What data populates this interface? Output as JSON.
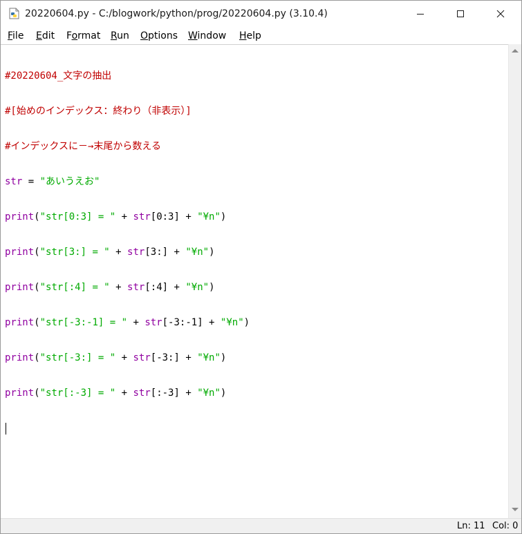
{
  "window": {
    "title": "20220604.py - C:/blogwork/python/prog/20220604.py (3.10.4)"
  },
  "title_buttons": {
    "minimize_icon": "minimize-icon",
    "maximize_icon": "maximize-icon",
    "close_icon": "close-icon"
  },
  "menu": [
    {
      "mnemonic": "F",
      "rest": "ile"
    },
    {
      "mnemonic": "E",
      "rest": "dit"
    },
    {
      "lead": "F",
      "mnemonic": "o",
      "rest": "rmat"
    },
    {
      "mnemonic": "R",
      "rest": "un"
    },
    {
      "mnemonic": "O",
      "rest": "ptions"
    },
    {
      "mnemonic": "W",
      "rest": "indow"
    },
    {
      "mnemonic": "H",
      "rest": "elp"
    }
  ],
  "code_lines": [
    [
      {
        "t": "#20220604_文字の抽出",
        "k": "comment"
      }
    ],
    [
      {
        "t": "#[始めのインデックス：終わり（非表示）]",
        "k": "comment"
      }
    ],
    [
      {
        "t": "#インデックスに－→末尾から数える",
        "k": "comment"
      }
    ],
    [
      {
        "t": "str",
        "k": "builtin"
      },
      {
        "t": " = ",
        "k": "plain"
      },
      {
        "t": "\"あいうえお\"",
        "k": "string"
      }
    ],
    [
      {
        "t": "print",
        "k": "builtin"
      },
      {
        "t": "(",
        "k": "plain"
      },
      {
        "t": "\"str[0:3] = \"",
        "k": "string"
      },
      {
        "t": " + ",
        "k": "plain"
      },
      {
        "t": "str",
        "k": "builtin"
      },
      {
        "t": "[0:3] + ",
        "k": "plain"
      },
      {
        "t": "\"¥n\"",
        "k": "string"
      },
      {
        "t": ")",
        "k": "plain"
      }
    ],
    [
      {
        "t": "print",
        "k": "builtin"
      },
      {
        "t": "(",
        "k": "plain"
      },
      {
        "t": "\"str[3:] = \"",
        "k": "string"
      },
      {
        "t": " + ",
        "k": "plain"
      },
      {
        "t": "str",
        "k": "builtin"
      },
      {
        "t": "[3:] + ",
        "k": "plain"
      },
      {
        "t": "\"¥n\"",
        "k": "string"
      },
      {
        "t": ")",
        "k": "plain"
      }
    ],
    [
      {
        "t": "print",
        "k": "builtin"
      },
      {
        "t": "(",
        "k": "plain"
      },
      {
        "t": "\"str[:4] = \"",
        "k": "string"
      },
      {
        "t": " + ",
        "k": "plain"
      },
      {
        "t": "str",
        "k": "builtin"
      },
      {
        "t": "[:4] + ",
        "k": "plain"
      },
      {
        "t": "\"¥n\"",
        "k": "string"
      },
      {
        "t": ")",
        "k": "plain"
      }
    ],
    [
      {
        "t": "print",
        "k": "builtin"
      },
      {
        "t": "(",
        "k": "plain"
      },
      {
        "t": "\"str[-3:-1] = \"",
        "k": "string"
      },
      {
        "t": " + ",
        "k": "plain"
      },
      {
        "t": "str",
        "k": "builtin"
      },
      {
        "t": "[-3:-1] + ",
        "k": "plain"
      },
      {
        "t": "\"¥n\"",
        "k": "string"
      },
      {
        "t": ")",
        "k": "plain"
      }
    ],
    [
      {
        "t": "print",
        "k": "builtin"
      },
      {
        "t": "(",
        "k": "plain"
      },
      {
        "t": "\"str[-3:] = \"",
        "k": "string"
      },
      {
        "t": " + ",
        "k": "plain"
      },
      {
        "t": "str",
        "k": "builtin"
      },
      {
        "t": "[-3:] + ",
        "k": "plain"
      },
      {
        "t": "\"¥n\"",
        "k": "string"
      },
      {
        "t": ")",
        "k": "plain"
      }
    ],
    [
      {
        "t": "print",
        "k": "builtin"
      },
      {
        "t": "(",
        "k": "plain"
      },
      {
        "t": "\"str[:-3] = \"",
        "k": "string"
      },
      {
        "t": " + ",
        "k": "plain"
      },
      {
        "t": "str",
        "k": "builtin"
      },
      {
        "t": "[:-3] + ",
        "k": "plain"
      },
      {
        "t": "\"¥n\"",
        "k": "string"
      },
      {
        "t": ")",
        "k": "plain"
      }
    ]
  ],
  "syntax_colors": {
    "comment": "#c00000",
    "builtin": "#9000a0",
    "string": "#00aa00",
    "plain": "#000000"
  },
  "status": {
    "line": "Ln: 11",
    "col": "Col: 0"
  }
}
